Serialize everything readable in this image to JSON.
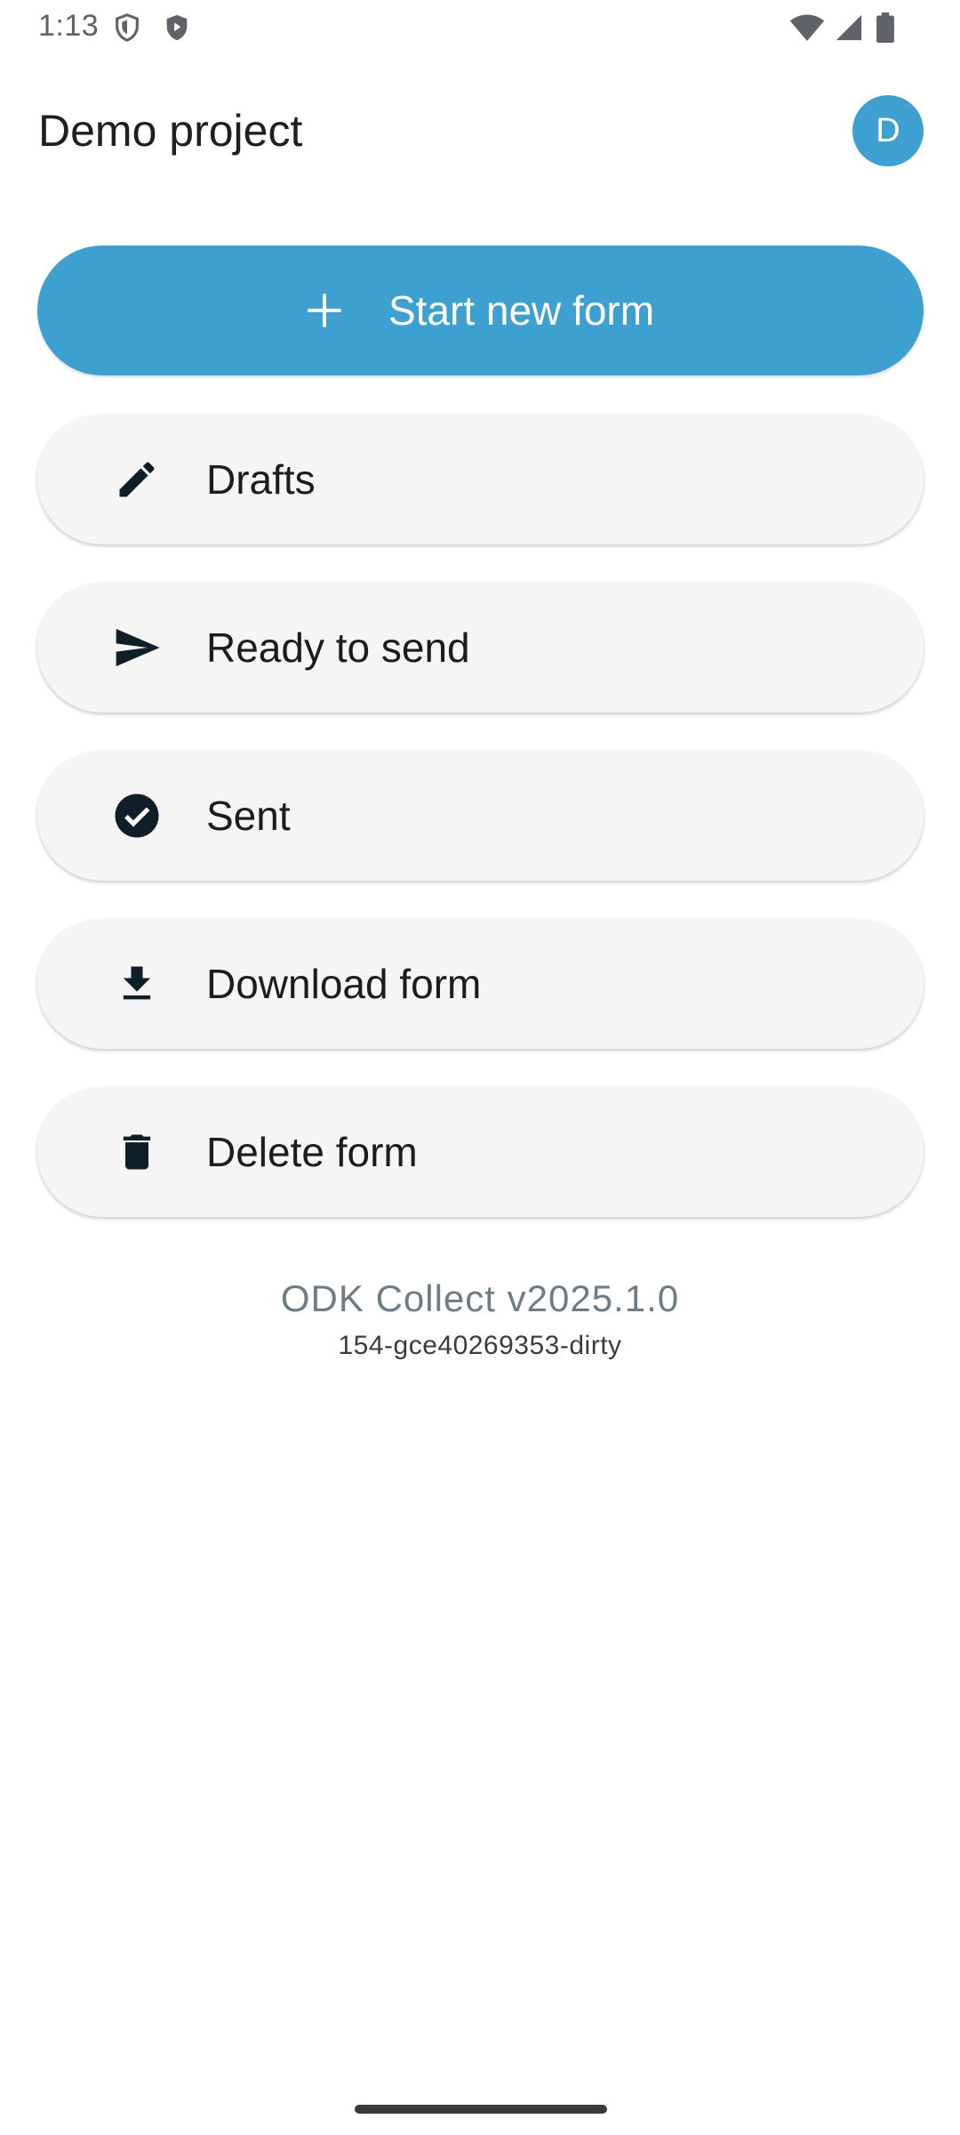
{
  "status_bar": {
    "time": "1:13",
    "icons": [
      "shield-outline-icon",
      "shield-play-icon",
      "wifi-icon",
      "signal-icon",
      "battery-icon"
    ]
  },
  "app_bar": {
    "title": "Demo project",
    "avatar_initial": "D"
  },
  "primary_action": {
    "label": "Start new form",
    "icon": "plus-icon",
    "color": "#3ea0d0"
  },
  "menu": [
    {
      "label": "Drafts",
      "icon": "pencil-icon"
    },
    {
      "label": "Ready to send",
      "icon": "send-icon"
    },
    {
      "label": "Sent",
      "icon": "check-circle-icon"
    },
    {
      "label": "Download form",
      "icon": "download-icon"
    },
    {
      "label": "Delete form",
      "icon": "trash-icon"
    }
  ],
  "footer": {
    "version": "ODK Collect v2025.1.0",
    "build": "154-gce40269353-dirty"
  }
}
